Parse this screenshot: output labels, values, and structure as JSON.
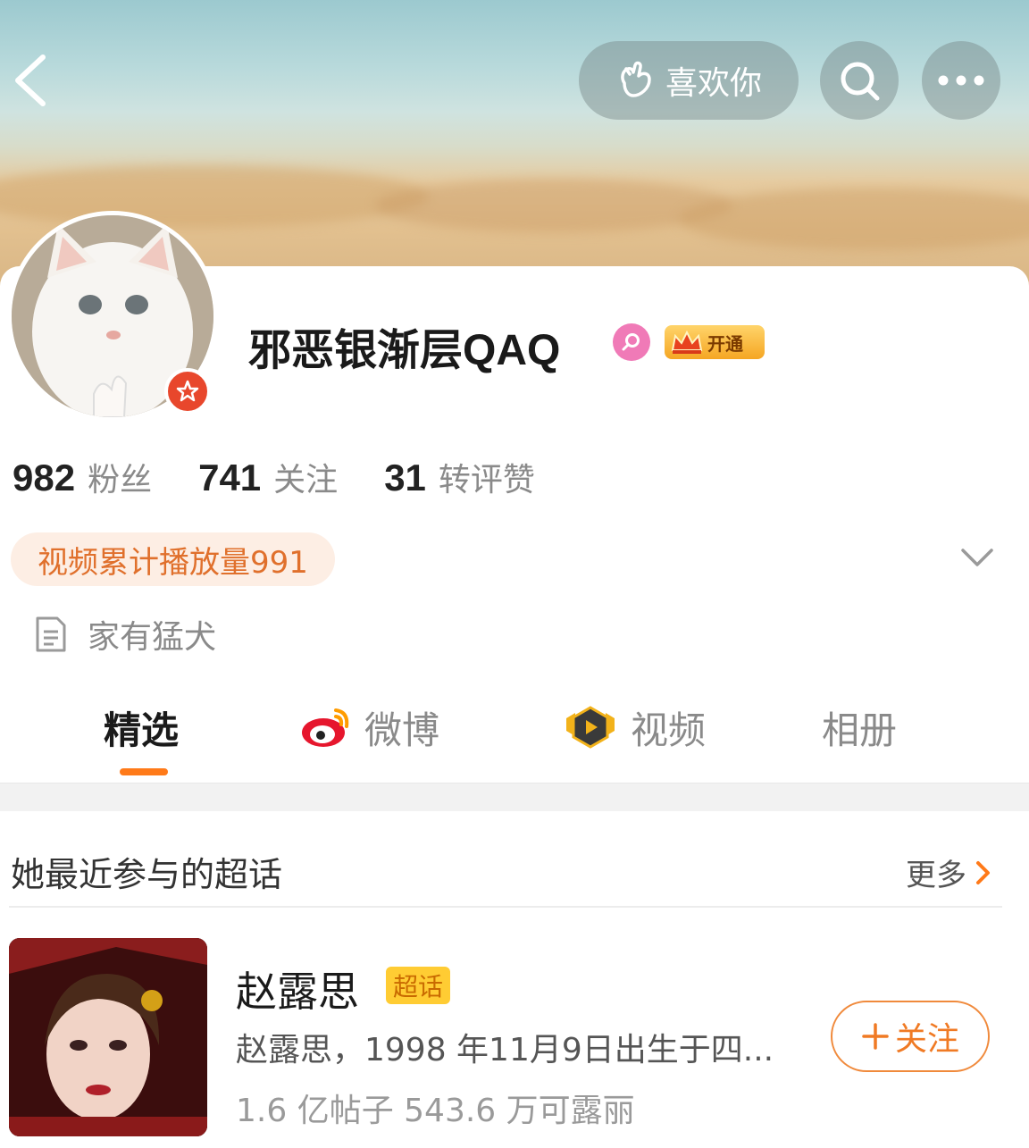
{
  "header": {
    "like_label": "喜欢你"
  },
  "profile": {
    "name": "邪恶银渐层QAQ",
    "vip_label": "开通",
    "stats": [
      {
        "num": "982",
        "label": "粉丝"
      },
      {
        "num": "741",
        "label": "关注"
      },
      {
        "num": "31",
        "label": "转评赞"
      }
    ],
    "video_pill": "视频累计播放量991",
    "bio": "家有猛犬"
  },
  "tabs": [
    {
      "label": "精选",
      "icon": "none"
    },
    {
      "label": "微博",
      "icon": "weibo-icon"
    },
    {
      "label": "视频",
      "icon": "video-icon"
    },
    {
      "label": "相册",
      "icon": "none"
    }
  ],
  "section": {
    "title": "她最近参与的超话",
    "more_label": "更多"
  },
  "topic": {
    "name": "赵露思",
    "tag": "超话",
    "desc": "赵露思，1998 年11月9日出生于四...",
    "meta": "1.6 亿帖子 543.6 万可露丽",
    "follow_label": "关注"
  },
  "colors": {
    "accent": "#ff7a19",
    "follow": "#f07a24",
    "pill_bg": "#fdeee4"
  }
}
